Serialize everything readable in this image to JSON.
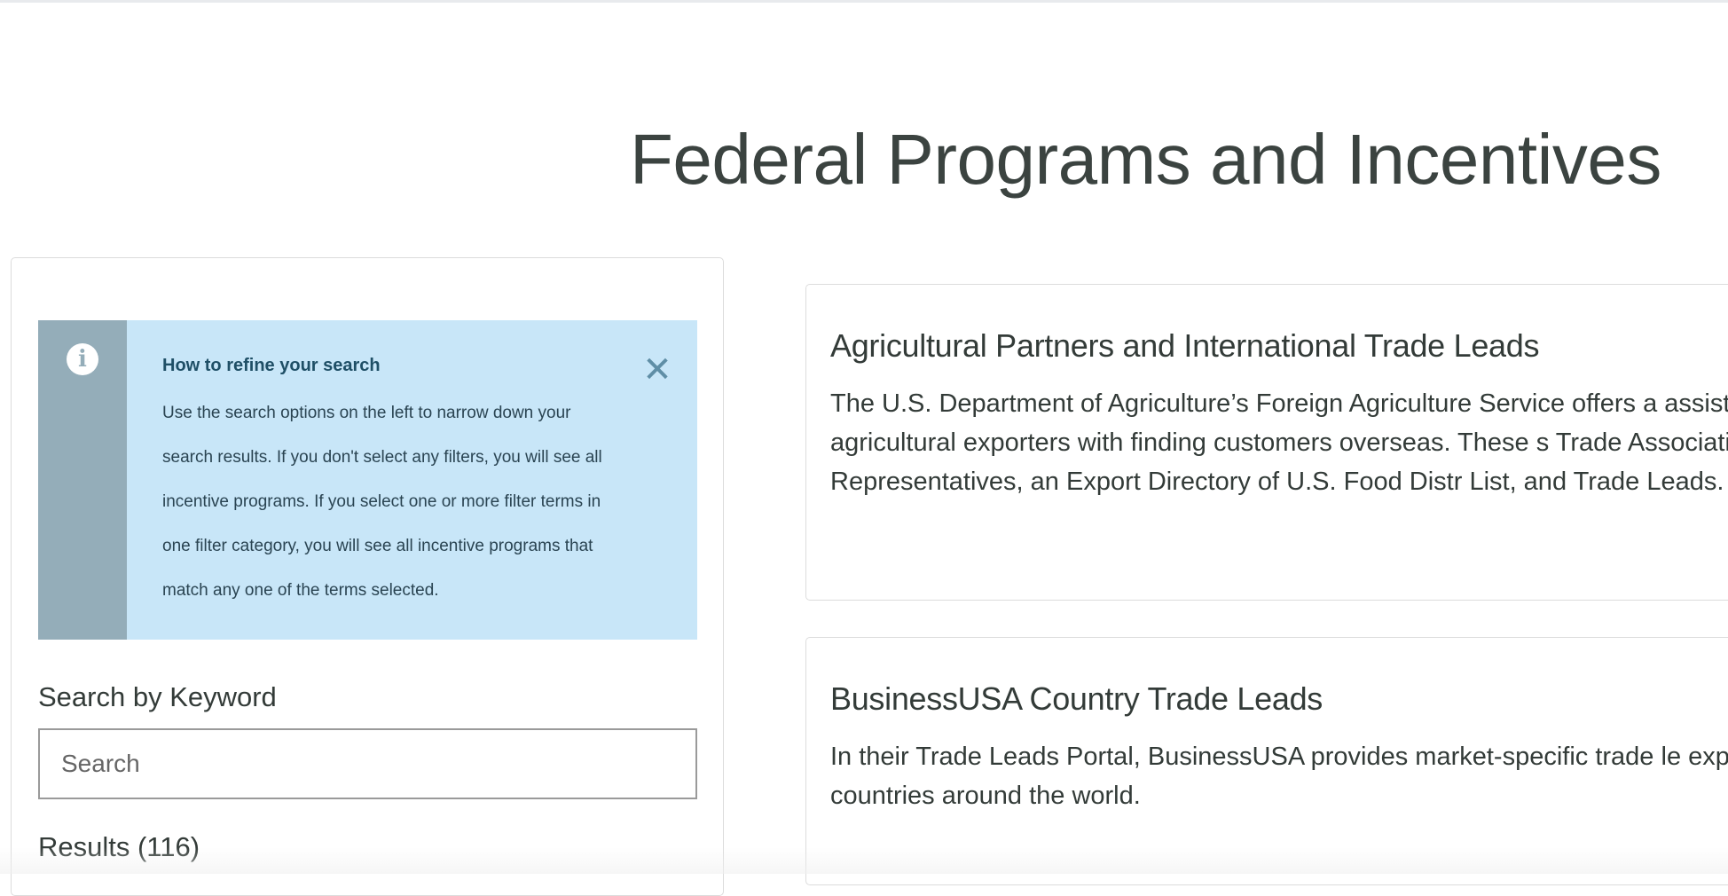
{
  "page": {
    "title": "Federal Programs and Incentives"
  },
  "info_box": {
    "icon": "info-icon",
    "title": "How to refine your search",
    "lines": [
      "Use the search options on the left to narrow down your",
      "search results. If you don't select any filters, you will see all",
      "incentive programs. If you select one or more filter terms in",
      "one filter category, you will see all incentive programs that",
      "match any one of the terms selected."
    ],
    "close_icon": "close-icon",
    "close_glyph": "✕"
  },
  "search": {
    "label": "Search by Keyword",
    "placeholder": "Search",
    "value": ""
  },
  "results": {
    "label": "Results (116)"
  },
  "cards": [
    {
      "title": "Agricultural Partners and International Trade Leads",
      "description": "The U.S. Department of Agriculture’s Foreign Agriculture Service offers a assist U.S. agricultural exporters with finding customers overseas. These s Trade Association Representatives, an Export Directory of U.S. Food Distr List, and Trade Leads."
    },
    {
      "title": "BusinessUSA Country Trade Leads",
      "description": "In their Trade Leads Portal, BusinessUSA provides market-specific trade le exporting to countries around the world."
    }
  ],
  "colors": {
    "info_background": "#c8e6f8",
    "info_rail": "#94adb9",
    "text": "#333b38"
  }
}
